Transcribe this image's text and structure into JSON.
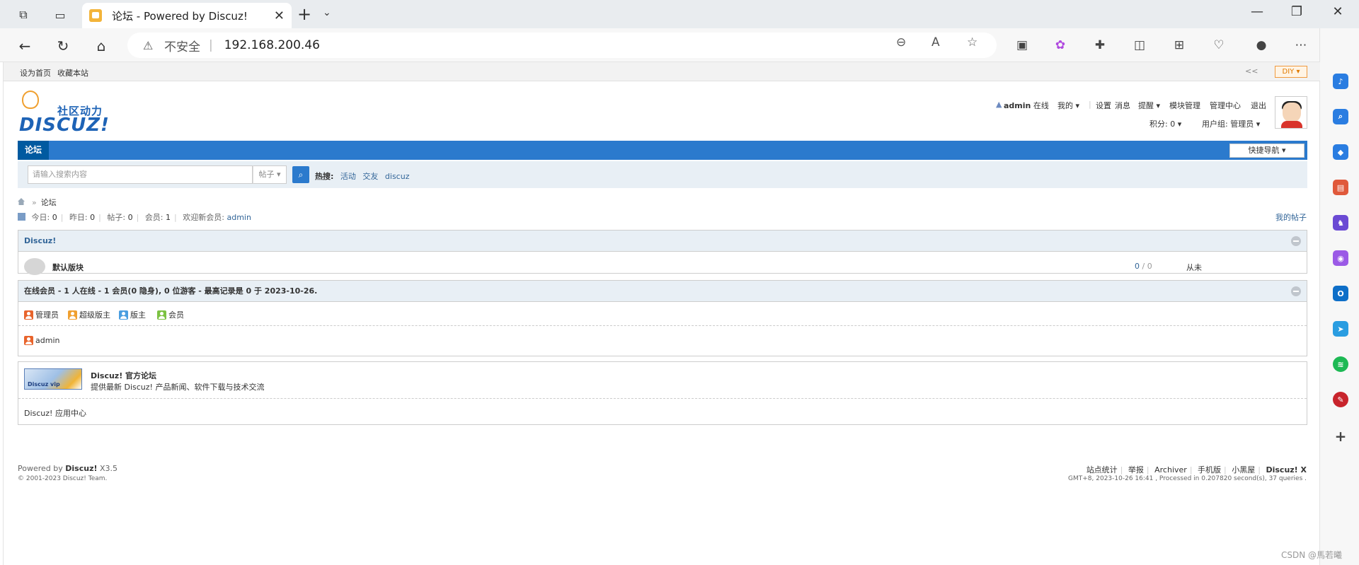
{
  "browser": {
    "tab_title": "论坛 - Powered by Discuz!",
    "insecure_label": "不安全",
    "url": "192.168.200.46",
    "close_glyph": "✕",
    "new_tab_glyph": "+",
    "tab_list_glyph": "⌄",
    "win_min": "—",
    "win_restore": "❐",
    "win_close": "✕"
  },
  "topbar": {
    "set_home": "设为首页",
    "bookmark": "收藏本站",
    "diy": "DIY",
    "tools": "<<"
  },
  "logo": {
    "cn": "社区动力",
    "en": "DISCUZ!"
  },
  "user_menu": {
    "username": "admin",
    "online": "在线",
    "mine": "我的",
    "settings": "设置",
    "messages": "消息",
    "reminders": "提醒",
    "module_mgmt": "模块管理",
    "admin_center": "管理中心",
    "logout": "退出",
    "credits": "积分: 0",
    "usergroup": "用户组: 管理员"
  },
  "nav": {
    "current": "论坛",
    "quick_nav": "快捷导航"
  },
  "search": {
    "placeholder": "请输入搜索内容",
    "type": "帖子",
    "hot_label": "热搜:",
    "hot_words": [
      "活动",
      "交友",
      "discuz"
    ]
  },
  "breadcrumb": {
    "forum": "论坛"
  },
  "stats": {
    "today_label": "今日:",
    "today": "0",
    "yesterday_label": "昨日:",
    "yesterday": "0",
    "threads_label": "帖子:",
    "threads": "0",
    "members_label": "会员:",
    "members": "1",
    "welcome_label": "欢迎新会员:",
    "newest": "admin",
    "my_threads": "我的帖子"
  },
  "category": {
    "name": "Discuz!",
    "forums": [
      {
        "name": "默认版块",
        "threads": "0",
        "posts": "0",
        "last": "从未"
      }
    ]
  },
  "online": {
    "header": "在线会员 - 1 人在线 - 1 会员(0 隐身), 0 位游客 - 最高记录是 0 于 2023-10-26.",
    "legend": [
      {
        "label": "管理员",
        "color": "#e8642c"
      },
      {
        "label": "超级版主",
        "color": "#f0a030"
      },
      {
        "label": "版主",
        "color": "#4a9ee0"
      },
      {
        "label": "会员",
        "color": "#7cc242"
      }
    ],
    "users": [
      {
        "name": "admin",
        "color": "#e8642c"
      }
    ]
  },
  "links": {
    "banner_text": "Discuz vip",
    "title": "Discuz! 官方论坛",
    "desc": "提供最新 Discuz! 产品新闻、软件下载与技术交流",
    "app_center": "Discuz! 应用中心"
  },
  "footer": {
    "powered_prefix": "Powered by",
    "powered_brand": "Discuz!",
    "version": "X3.5",
    "copyright": "© 2001-2023 Discuz! Team.",
    "links": [
      "站点统计",
      "举报",
      "Archiver",
      "手机版",
      "小黑屋"
    ],
    "brand": "Discuz! X",
    "processed": "GMT+8, 2023-10-26 16:41 , Processed in 0.207820 second(s), 37 queries ."
  },
  "watermark": "CSDN @馬若曦"
}
